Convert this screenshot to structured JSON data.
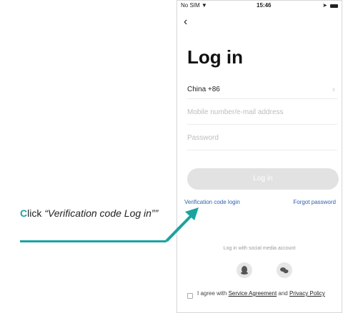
{
  "status_bar": {
    "carrier": "No SIM",
    "time": "15:46"
  },
  "title": "Log in",
  "country_field": {
    "value": "China +86"
  },
  "mobile_field": {
    "placeholder": "Mobile number/e-mail address"
  },
  "password_field": {
    "placeholder": "Password"
  },
  "login_button": "Log in",
  "verification_link": "Verification code login",
  "forgot_link": "Forgot password",
  "social_label": "Log in with social media account",
  "agreement": {
    "prefix": "I agree with ",
    "service": "Service Agreement",
    "and": " and ",
    "privacy": "Privacy Policy"
  },
  "annotation": {
    "first_letter": "C",
    "rest": "lick ",
    "quoted": "“Verification code Log in””"
  },
  "colors": {
    "accent": "#1aa3a0",
    "link": "#2e5fb0",
    "button": "#e2e2e2"
  },
  "icons": [
    "wifi-icon",
    "location-arrow-icon",
    "battery-icon",
    "back-chevron-icon",
    "chevron-right-icon",
    "qq-icon",
    "wechat-icon",
    "checkbox-icon",
    "arrow-icon"
  ]
}
